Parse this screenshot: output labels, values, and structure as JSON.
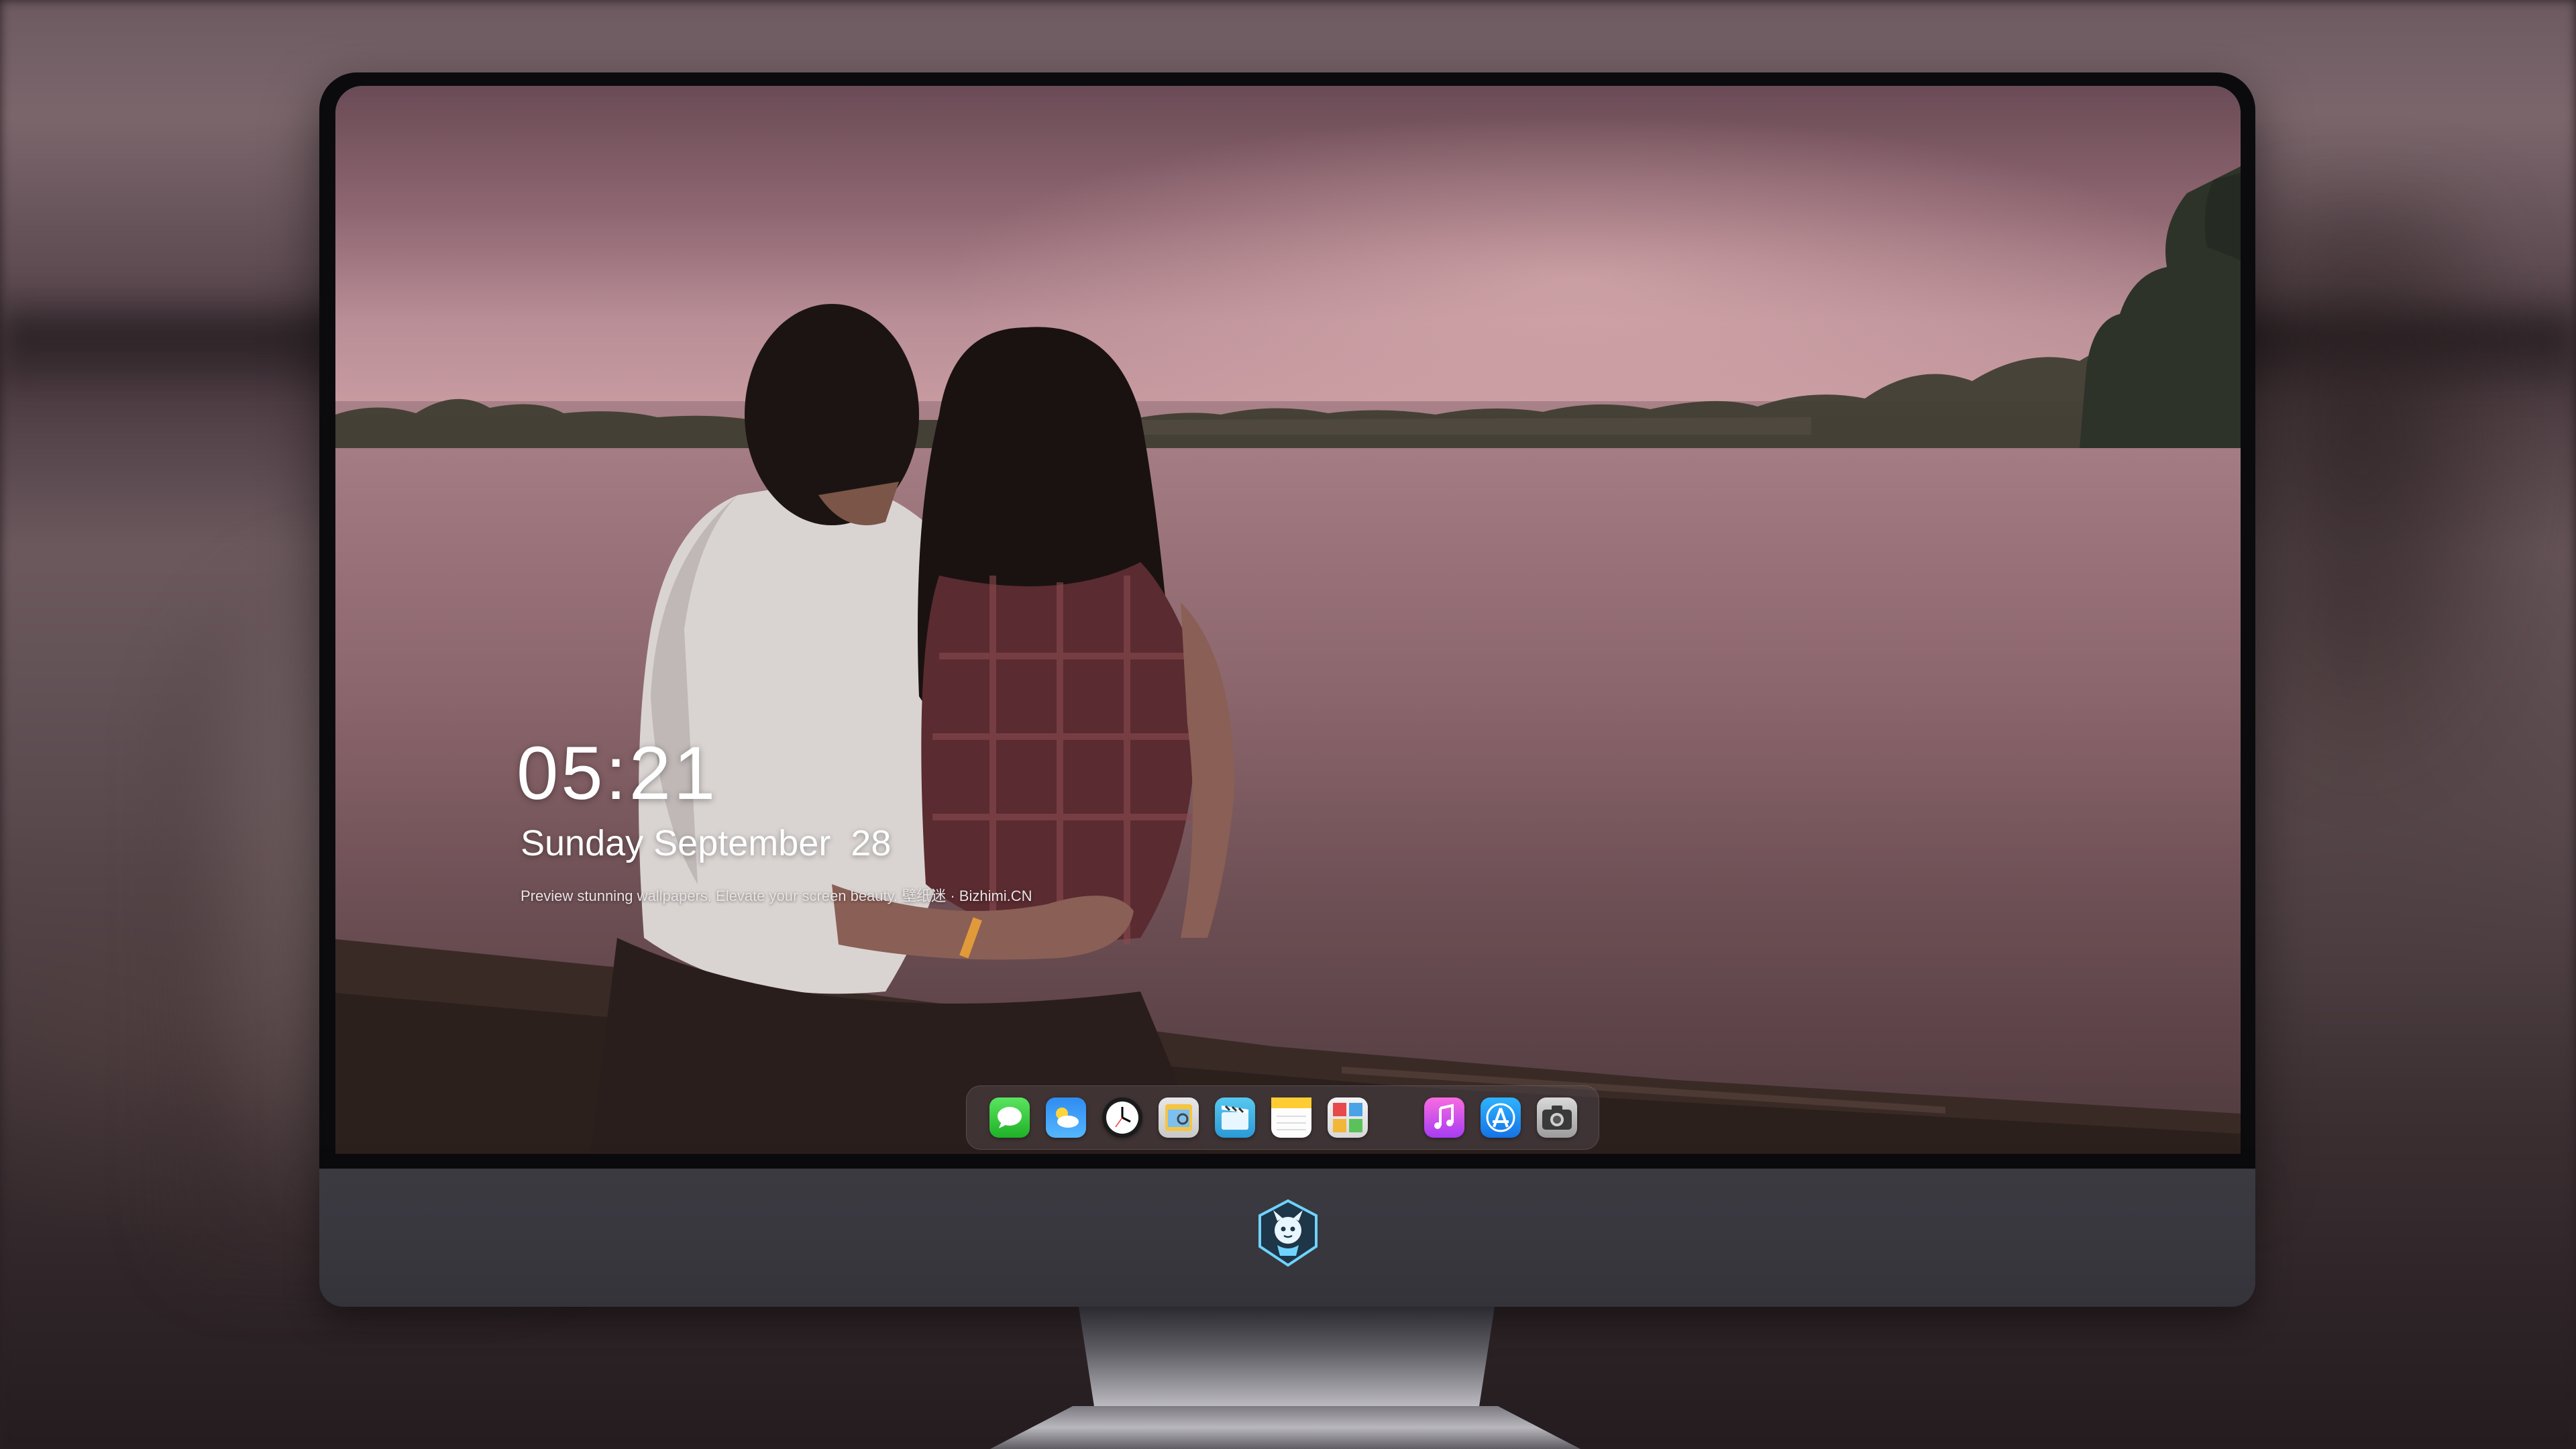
{
  "lockscreen": {
    "time": "05:21",
    "date": "Sunday September  28",
    "tagline": "Preview stunning wallpapers. Elevate your screen beauty. 壁纸迷 · Bizhimi.CN"
  },
  "dock": {
    "apps": [
      {
        "icon": "messages-icon"
      },
      {
        "icon": "weather-icon"
      },
      {
        "icon": "clock-icon"
      },
      {
        "icon": "preview-icon"
      },
      {
        "icon": "clips-icon"
      },
      {
        "icon": "notes-icon"
      },
      {
        "icon": "photo-booth-icon"
      },
      {
        "icon": "itunes-icon"
      },
      {
        "icon": "app-store-icon"
      },
      {
        "icon": "camera-icon"
      }
    ]
  },
  "chin": {
    "logo": "bizhimi-mascot-logo"
  },
  "colors": {
    "sky_pink": "#c79ba0",
    "lake": "#9b747b",
    "bezel": "#0b0b0d",
    "chin": "#38373e"
  }
}
